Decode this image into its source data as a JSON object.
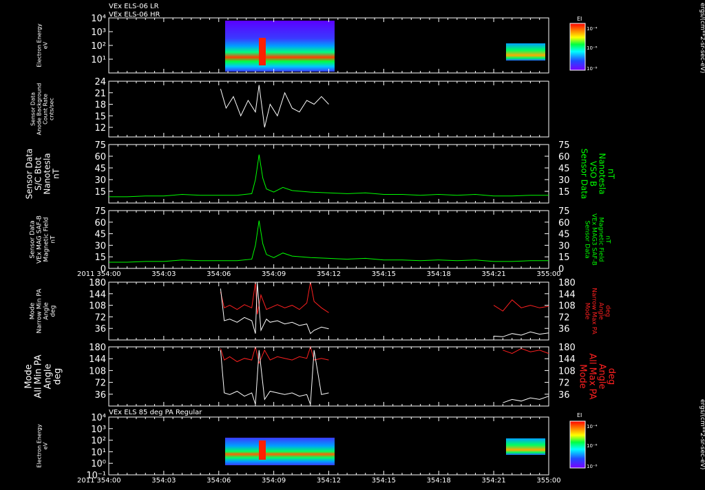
{
  "header": {
    "line1": "VEx ELS-06 LR",
    "line2": "VEx ELS-06 HR",
    "panel7_title": "VEx ELS 85 deg PA Regular"
  },
  "time_axis": {
    "year": "2011",
    "ticks": [
      "354:00",
      "354:03",
      "354:06",
      "354:09",
      "354:12",
      "354:15",
      "354:18",
      "354:21",
      "355:00"
    ]
  },
  "colorbars": {
    "label": "EI",
    "top_ticks": [
      "10⁻⁴",
      "10⁻⁶",
      "10⁻⁸"
    ],
    "bottom_ticks": [
      "10⁻⁴",
      "10⁻⁶",
      "10⁻⁸"
    ],
    "unit_label": "ergs/(cm**2-sr-sec-eV)"
  },
  "chart_data": [
    {
      "id": "panel1",
      "type": "heatmap",
      "ylabel": [
        "Electron Energy",
        "eV"
      ],
      "yticks": [
        "10⁴",
        "10³",
        "10²",
        "10¹"
      ],
      "ylog": true,
      "yrange": [
        1,
        10000
      ],
      "data_blocks": [
        {
          "t_start": 6.1,
          "t_end": 12.1,
          "e_min": 3,
          "e_max": 10000
        },
        {
          "t_start": 21.5,
          "t_end": 23.8,
          "e_min": 5,
          "e_max": 200
        }
      ]
    },
    {
      "id": "panel2",
      "type": "line",
      "ylabel": [
        "Sensor Data",
        "Anode Background",
        "Count Rate",
        "cnts/sec"
      ],
      "yticks": [
        12,
        15,
        18,
        21,
        24
      ],
      "ylim": [
        9.5,
        24
      ],
      "series": [
        {
          "color": "#ffffff",
          "x": [
            6.1,
            6.4,
            6.8,
            7.2,
            7.6,
            8.0,
            8.2,
            8.5,
            8.8,
            9.2,
            9.6,
            10.0,
            10.4,
            10.8,
            11.2,
            11.6,
            12.0
          ],
          "y": [
            22,
            17,
            20,
            15,
            19,
            16,
            23,
            12,
            18,
            15,
            21,
            17,
            16,
            19,
            18,
            20,
            18
          ]
        }
      ]
    },
    {
      "id": "panel3",
      "type": "line",
      "ylabel": [
        "Sensor Data",
        "S/C Btot",
        "Nanotesla",
        "nT"
      ],
      "ylabel_right": [
        "Sensor Data",
        "VSO B",
        "Nanotesla",
        "nT"
      ],
      "yticks": [
        15,
        30,
        45,
        60,
        75
      ],
      "ylim": [
        0,
        75
      ],
      "series": [
        {
          "color": "#00ff00",
          "x": [
            0,
            1,
            2,
            3,
            4,
            5,
            6,
            7,
            7.8,
            8.0,
            8.2,
            8.4,
            8.6,
            9.0,
            9.5,
            10,
            11,
            12,
            13,
            14,
            15,
            16,
            17,
            18,
            19,
            20,
            21,
            22,
            23,
            24
          ],
          "y": [
            8,
            8,
            9,
            9,
            11,
            10,
            10,
            10,
            12,
            30,
            62,
            32,
            18,
            14,
            20,
            16,
            14,
            13,
            12,
            13,
            11,
            11,
            10,
            11,
            10,
            11,
            9,
            9,
            10,
            10
          ]
        }
      ]
    },
    {
      "id": "panel4",
      "type": "line",
      "ylabel": [
        "Sensor Data",
        "VEx MAG SAF-B",
        "Magnetic Field",
        "nT"
      ],
      "ylabel_right": [
        "Sensor Data",
        "VEx MAG3 SAF-B",
        "Magnetic Field",
        "nT"
      ],
      "yticks": [
        0,
        15,
        30,
        45,
        60,
        75
      ],
      "ylim": [
        0,
        75
      ],
      "series": [
        {
          "color": "#00ff00",
          "x": [
            0,
            1,
            2,
            3,
            4,
            5,
            6,
            7,
            7.8,
            8.0,
            8.2,
            8.4,
            8.6,
            9.0,
            9.5,
            10,
            11,
            12,
            13,
            14,
            15,
            16,
            17,
            18,
            19,
            20,
            21,
            22,
            23,
            24
          ],
          "y": [
            8,
            8,
            9,
            9,
            11,
            10,
            10,
            10,
            12,
            30,
            62,
            32,
            18,
            14,
            20,
            16,
            14,
            13,
            12,
            13,
            11,
            11,
            10,
            11,
            10,
            11,
            9,
            9,
            10,
            10
          ]
        }
      ]
    },
    {
      "id": "panel5",
      "type": "line",
      "ylabel": [
        "Mode",
        "Narrow Min PA",
        "Angle",
        "deg"
      ],
      "ylabel_right": [
        "Mode",
        "Narrow Max PA",
        "Angle",
        "deg"
      ],
      "yticks": [
        36,
        72,
        108,
        144,
        180
      ],
      "ylim": [
        0,
        180
      ],
      "series": [
        {
          "color": "#ff2020",
          "x": [
            6.1,
            6.3,
            6.6,
            7.0,
            7.4,
            7.8,
            8.0,
            8.1,
            8.3,
            8.6,
            8.8,
            9.2,
            9.6,
            10.0,
            10.4,
            10.8,
            11.0,
            11.2,
            11.6,
            12.0,
            21.0,
            21.5,
            22.0,
            22.5,
            23.0,
            23.5,
            24.0
          ],
          "y": [
            150,
            100,
            108,
            95,
            110,
            100,
            180,
            80,
            140,
            95,
            100,
            110,
            100,
            108,
            95,
            115,
            180,
            120,
            100,
            85,
            108,
            90,
            125,
            100,
            108,
            100,
            105
          ]
        },
        {
          "color": "#ffffff",
          "x": [
            6.1,
            6.3,
            6.6,
            7.0,
            7.4,
            7.8,
            8.0,
            8.1,
            8.3,
            8.6,
            8.8,
            9.2,
            9.6,
            10.0,
            10.4,
            10.8,
            11.0,
            11.2,
            11.6,
            12.0,
            21.0,
            21.5,
            22.0,
            22.5,
            23.0,
            23.5,
            24.0
          ],
          "y": [
            160,
            60,
            65,
            55,
            70,
            60,
            20,
            180,
            30,
            65,
            55,
            60,
            50,
            55,
            45,
            50,
            20,
            30,
            40,
            35,
            12,
            10,
            20,
            15,
            25,
            18,
            22
          ]
        }
      ]
    },
    {
      "id": "panel6",
      "type": "line",
      "ylabel": [
        "Mode",
        "All Min PA",
        "Angle",
        "deg"
      ],
      "ylabel_right": [
        "Mode",
        "All Max PA",
        "Angle",
        "deg"
      ],
      "yticks": [
        36,
        72,
        108,
        144,
        180
      ],
      "ylim": [
        0,
        180
      ],
      "series": [
        {
          "color": "#ff2020",
          "x": [
            6.1,
            6.3,
            6.6,
            7.0,
            7.4,
            7.8,
            8.0,
            8.2,
            8.5,
            8.8,
            9.2,
            9.6,
            10.0,
            10.4,
            10.8,
            11.0,
            11.2,
            11.6,
            12.0,
            21.5,
            22.0,
            22.5,
            23.0,
            23.5,
            24.0
          ],
          "y": [
            175,
            140,
            150,
            135,
            145,
            140,
            180,
            130,
            170,
            140,
            150,
            145,
            140,
            150,
            145,
            180,
            140,
            145,
            140,
            170,
            160,
            175,
            165,
            170,
            160
          ]
        },
        {
          "color": "#ffffff",
          "x": [
            6.1,
            6.3,
            6.6,
            7.0,
            7.4,
            7.8,
            8.0,
            8.2,
            8.5,
            8.8,
            9.2,
            9.6,
            10.0,
            10.4,
            10.8,
            11.0,
            11.2,
            11.6,
            12.0,
            21.5,
            22.0,
            22.5,
            23.0,
            23.5,
            24.0
          ],
          "y": [
            170,
            40,
            35,
            45,
            30,
            40,
            5,
            170,
            20,
            45,
            40,
            35,
            40,
            30,
            35,
            5,
            170,
            35,
            40,
            10,
            20,
            15,
            25,
            20,
            30
          ]
        }
      ]
    },
    {
      "id": "panel7",
      "type": "heatmap",
      "ylabel": [
        "Electron Energy",
        "eV"
      ],
      "yticks": [
        "10⁴",
        "10³",
        "10²",
        "10¹",
        "10⁰",
        "10⁻¹"
      ],
      "ylog": true,
      "yrange": [
        0.1,
        10000
      ],
      "data_blocks": [
        {
          "t_start": 6.1,
          "t_end": 12.1,
          "e_min": 0.5,
          "e_max": 300
        },
        {
          "t_start": 21.5,
          "t_end": 23.8,
          "e_min": 5,
          "e_max": 200
        }
      ]
    }
  ]
}
